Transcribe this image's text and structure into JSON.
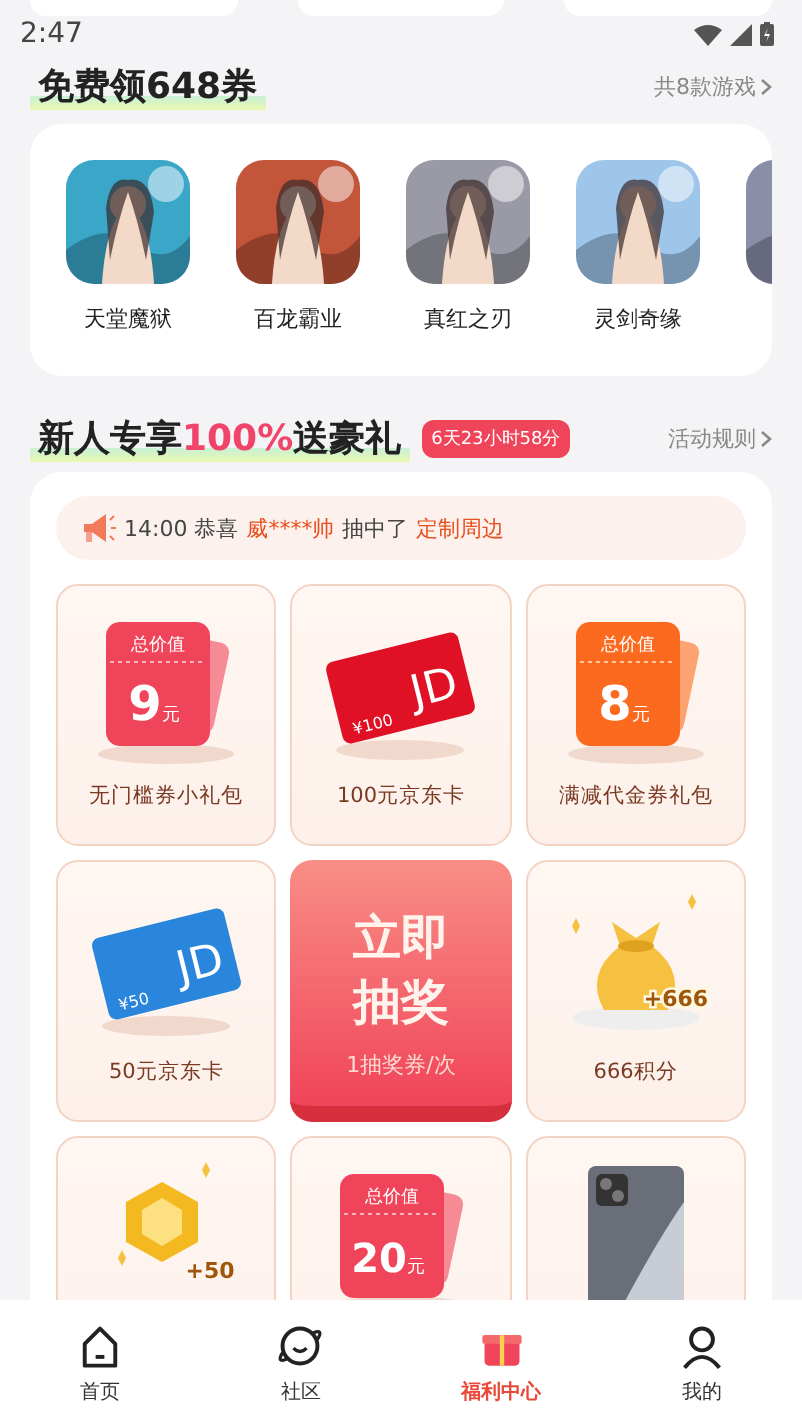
{
  "status_bar": {
    "time": "2:47"
  },
  "free_section": {
    "title": "免费领648券",
    "link": "共8款游戏",
    "games": [
      {
        "name": "天堂魔狱",
        "color": "#3aa6c8"
      },
      {
        "name": "百龙霸业",
        "color": "#c2553a"
      },
      {
        "name": "真红之刃",
        "color": "#9a9aa6"
      },
      {
        "name": "灵剑奇缘",
        "color": "#9ec6ea"
      },
      {
        "color": "#8a8ea8"
      }
    ]
  },
  "gift_section": {
    "title": [
      {
        "text": "新人专享",
        "highlight": false
      },
      {
        "text": "100%",
        "highlight": true
      },
      {
        "text": "送豪礼",
        "highlight": false
      }
    ],
    "countdown": "6天23小时58分",
    "link": "活动规则",
    "notice": [
      {
        "text": "14:00 恭喜",
        "highlight": false
      },
      {
        "text": "威****帅",
        "highlight": true
      },
      {
        "text": "抽中了",
        "highlight": false
      },
      {
        "text": "定制周边",
        "highlight": true
      }
    ],
    "prizes": [
      {
        "kind": "coupon",
        "tag": "总价值",
        "amount": "9",
        "unit": "元",
        "color": "#f0445a",
        "label": "无门槛券小礼包"
      },
      {
        "kind": "card",
        "value": "¥100",
        "brand": "JD",
        "color": "#e01025",
        "label": "100元京东卡"
      },
      {
        "kind": "coupon",
        "tag": "总价值",
        "amount": "8",
        "unit": "元",
        "color": "#fb6a1e",
        "label": "满减代金券礼包"
      },
      {
        "kind": "card",
        "value": "¥50",
        "brand": "JD",
        "color": "#2a86dc",
        "label": "50元京东卡"
      },
      {
        "kind": "draw",
        "title": "立即抽奖",
        "sub": "1抽奖券/次"
      },
      {
        "kind": "bag",
        "badge": "+666",
        "label": "666积分"
      },
      {
        "kind": "gem",
        "badge": "+50"
      },
      {
        "kind": "coupon",
        "tag": "总价值",
        "amount": "20",
        "unit": "元",
        "color": "#f0445a"
      },
      {
        "kind": "phone"
      }
    ]
  },
  "nav": [
    {
      "label": "首页",
      "selected": false
    },
    {
      "label": "社区",
      "selected": false
    },
    {
      "label": "福利中心",
      "selected": true
    },
    {
      "label": "我的",
      "selected": false
    }
  ]
}
